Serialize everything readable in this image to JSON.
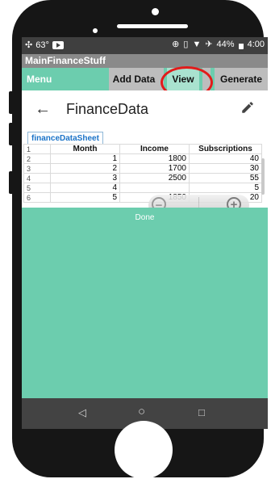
{
  "status_bar": {
    "temperature": "63°",
    "battery_percent": "44%",
    "time": "4:00"
  },
  "window_title": "MainFinanceStuff",
  "tabs": {
    "menu": "Menu",
    "add_data": "Add Data",
    "view": "View",
    "generate": "Generate"
  },
  "app_bar": {
    "title": "FinanceData"
  },
  "sheet_tab": "financeDataSheet",
  "table": {
    "headers": [
      "Month",
      "Income",
      "Subscriptions"
    ],
    "row_numbers": [
      "1",
      "2",
      "3",
      "4",
      "5",
      "6"
    ],
    "rows": [
      [
        "1",
        "1800",
        "40"
      ],
      [
        "2",
        "1700",
        "30"
      ],
      [
        "3",
        "2500",
        "55"
      ],
      [
        "4",
        "",
        "5"
      ],
      [
        "5",
        "1850",
        "20"
      ]
    ]
  },
  "done_label": "Done",
  "colors": {
    "accent": "#6ccdae",
    "highlight": "#e21b1b",
    "status_bar": "#3f3f3f",
    "title_bar": "#8a8a8a"
  }
}
